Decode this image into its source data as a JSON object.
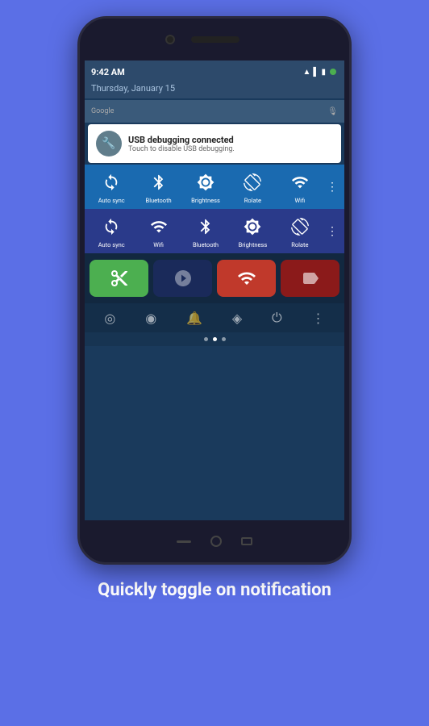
{
  "phone": {
    "status": {
      "time": "9:42 AM",
      "date": "Thursday, January 15"
    },
    "notification": {
      "title": "USB debugging connected",
      "subtitle": "Touch to disable USB debugging."
    },
    "toggle_row1": {
      "items": [
        {
          "label": "Auto sync",
          "icon": "↻"
        },
        {
          "label": "Bluetooth",
          "icon": "⚡"
        },
        {
          "label": "Brightness",
          "icon": "✦"
        },
        {
          "label": "Rolate",
          "icon": "⊘"
        },
        {
          "label": "Wifi",
          "icon": "▲"
        }
      ],
      "more_icon": "⋮"
    },
    "toggle_row2": {
      "items": [
        {
          "label": "Auto sync",
          "icon": "↻"
        },
        {
          "label": "Wifi",
          "icon": "▲"
        },
        {
          "label": "Bluetooth",
          "icon": "⚡"
        },
        {
          "label": "Brightness",
          "icon": "✦"
        },
        {
          "label": "Rolate",
          "icon": "⊘"
        }
      ],
      "more_icon": "⋮"
    }
  },
  "caption": {
    "text": "Quickly toggle on notification"
  }
}
